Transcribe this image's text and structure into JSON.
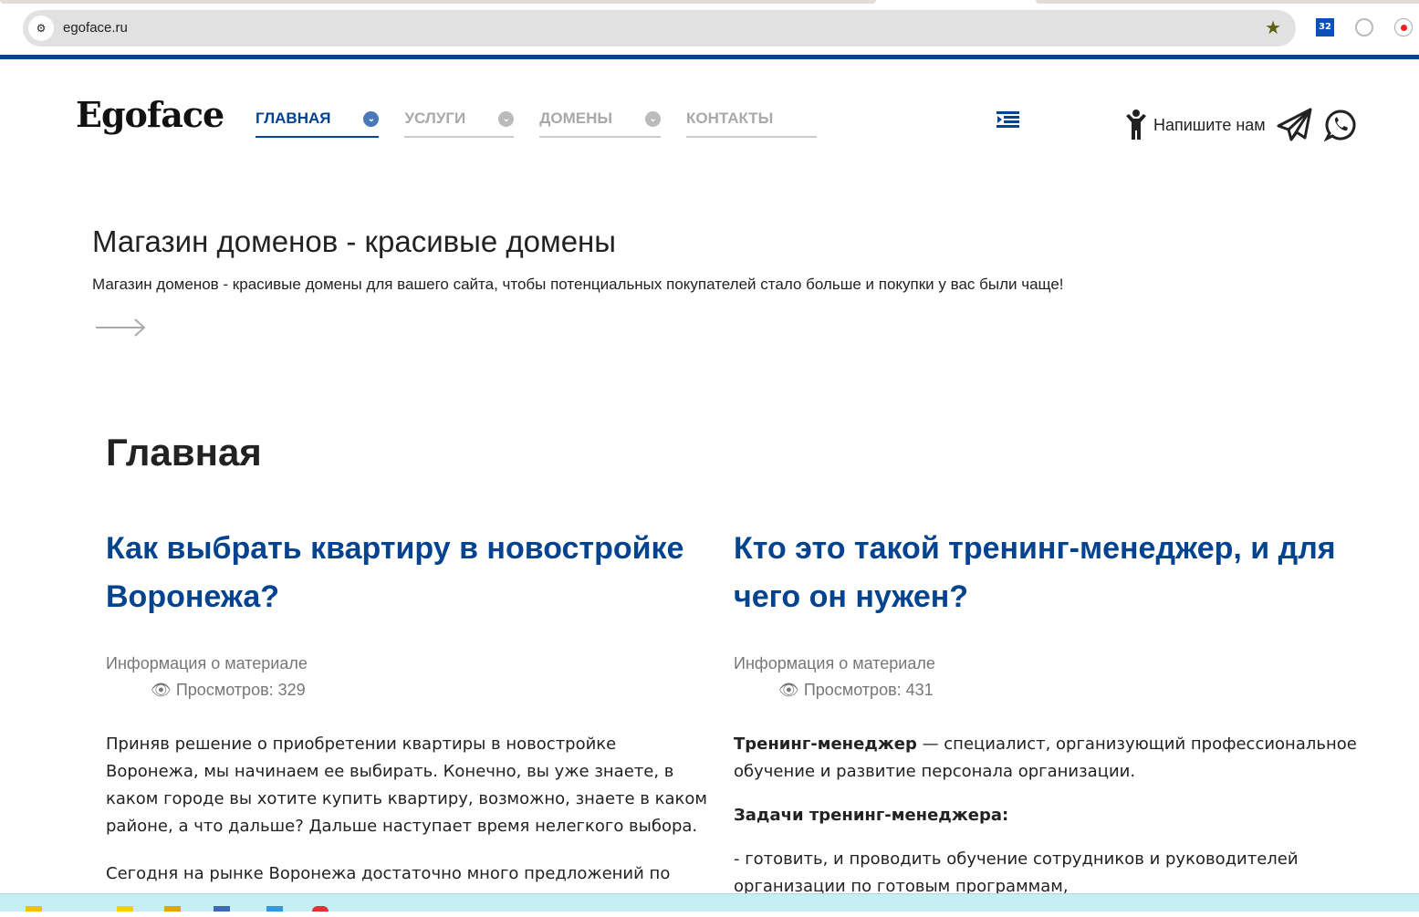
{
  "browser": {
    "url": "egoface.ru",
    "ext_badge": "32"
  },
  "header": {
    "logo": "Egoface",
    "nav": [
      {
        "label": "ГЛАВНАЯ",
        "active": true
      },
      {
        "label": "УСЛУГИ"
      },
      {
        "label": "ДОМЕНЫ"
      },
      {
        "label": "КОНТАКТЫ"
      }
    ],
    "contact_label": "Напишите нам"
  },
  "hero": {
    "title": "Магазин доменов - красивые домены",
    "subtitle": "Магазин доменов - красивые домены для вашего сайта, чтобы потенциальных покупателей стало больше и покупки у вас были чаще!"
  },
  "page_heading": "Главная",
  "articles": [
    {
      "title": "Как выбрать квартиру в новостройке Воронежа?",
      "meta": "Информация о материале",
      "views": "Просмотров: 329",
      "paragraphs": [
        "Приняв решение о приобретении квартиры в новостройке Воронежа, мы начинаем ее выбирать. Конечно, вы уже знаете, в каком городе вы хотите купить квартиру, возможно, знаете в каком районе, а что дальше? Дальше наступает время нелегкого выбора.",
        "Сегодня на рынке Воронежа достаточно много предложений по"
      ]
    },
    {
      "title": "Кто это такой тренинг-менеджер, и для чего он нужен?",
      "meta": "Информация о материале",
      "views": "Просмотров: 431",
      "lead_bold": "Тренинг-менеджер",
      "lead_rest": " — специалист, организующий профессиональное обучение и развитие персонала организации.",
      "subheading": "Задачи тренинг-менеджера:",
      "paragraphs": [
        "- готовить, и проводить обучение сотрудников и руководителей организации по готовым программам,"
      ]
    }
  ],
  "colors": {
    "brand": "#03438f",
    "taskbar": "#c6eef5"
  }
}
